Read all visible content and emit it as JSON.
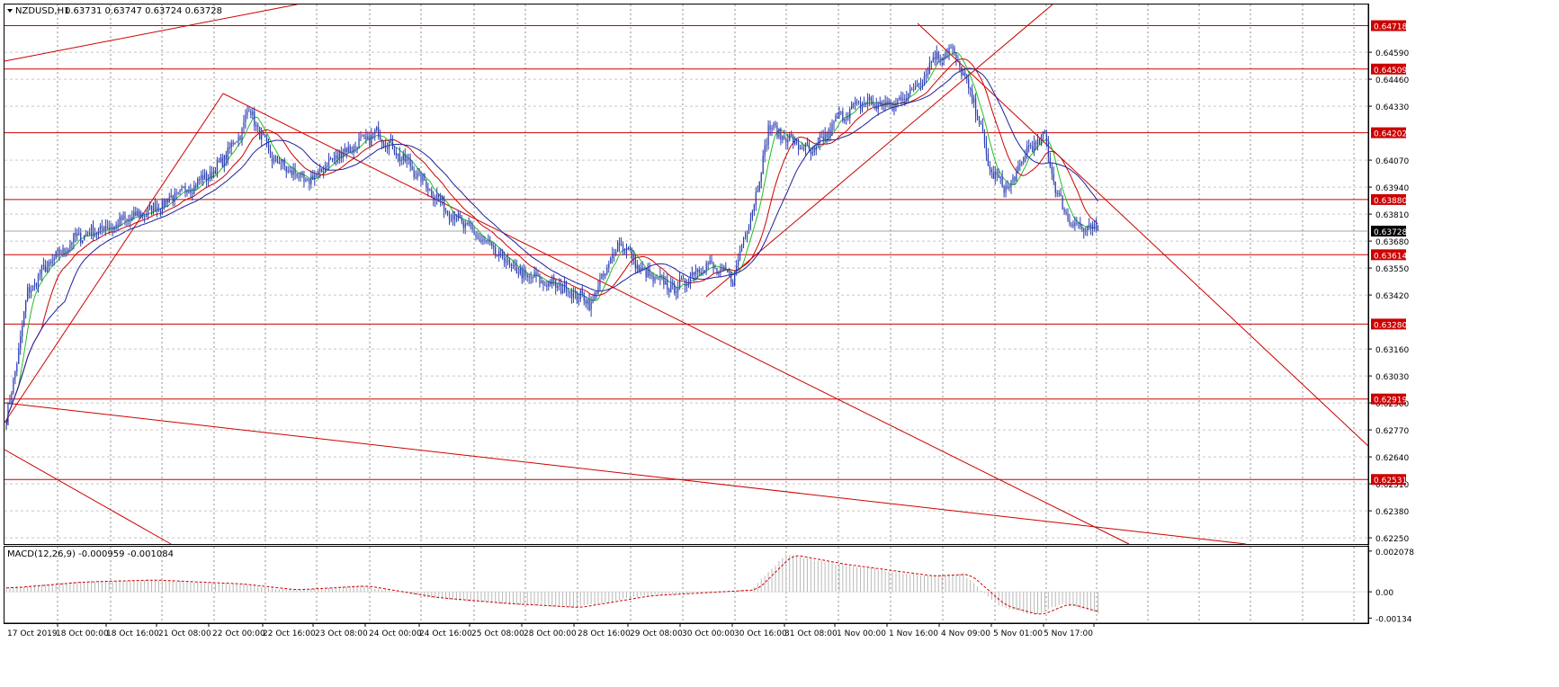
{
  "window": {
    "symbol": "NZDUSD,H1",
    "ohlc": "0.63731 0.63747 0.63724 0.63728"
  },
  "indicator": {
    "label": "MACD(12,26,9) -0.000959 -0.001084"
  },
  "price_axis": {
    "ticks": [
      "0.64590",
      "0.64460",
      "0.64330",
      "0.64070",
      "0.63940",
      "0.63810",
      "0.63680",
      "0.63550",
      "0.63420",
      "0.63160",
      "0.63030",
      "0.62900",
      "0.62770",
      "0.62640",
      "0.62510",
      "0.62380",
      "0.62250"
    ],
    "level_labels": [
      "0.64718",
      "0.64509",
      "0.64202",
      "0.63880",
      "0.63614",
      "0.63280",
      "0.62919",
      "0.62531"
    ],
    "current_price": "0.63728"
  },
  "macd_axis": {
    "ticks": [
      "0.002078",
      "0.00",
      "-0.00134"
    ]
  },
  "time_axis": {
    "labels": [
      "17 Oct 2019",
      "18 Oct 00:00",
      "18 Oct 16:00",
      "21 Oct 08:00",
      "22 Oct 00:00",
      "22 Oct 16:00",
      "23 Oct 08:00",
      "24 Oct 00:00",
      "24 Oct 16:00",
      "25 Oct 08:00",
      "28 Oct 00:00",
      "28 Oct 16:00",
      "29 Oct 08:00",
      "30 Oct 00:00",
      "30 Oct 16:00",
      "31 Oct 08:00",
      "1 Nov 00:00",
      "1 Nov 16:00",
      "4 Nov 09:00",
      "5 Nov 01:00",
      "5 Nov 17:00"
    ]
  },
  "colors": {
    "candle": "#2a3db0",
    "grid": "#c8c8c8",
    "level_line": "#cc0000",
    "ma_fast": "#20c020",
    "ma_mid": "#cc0000",
    "ma_slow": "#1e1e9e",
    "macd_hist": "#b8b8b8",
    "macd_signal": "#cc0000"
  },
  "chart_data": {
    "type": "candlestick",
    "symbol": "NZDUSD",
    "timeframe": "H1",
    "y_range": [
      0.6222,
      0.6482
    ],
    "horizontal_levels": [
      0.64718,
      0.64509,
      0.64202,
      0.6388,
      0.63614,
      0.6328,
      0.62919,
      0.62531
    ],
    "current_price": 0.63728,
    "price_path_anchors": [
      [
        0,
        0.6282
      ],
      [
        4,
        0.63
      ],
      [
        12,
        0.6343
      ],
      [
        22,
        0.6355
      ],
      [
        40,
        0.637
      ],
      [
        62,
        0.6376
      ],
      [
        82,
        0.6383
      ],
      [
        102,
        0.6393
      ],
      [
        118,
        0.6402
      ],
      [
        132,
        0.642
      ],
      [
        137,
        0.6432
      ],
      [
        148,
        0.641
      ],
      [
        158,
        0.6403
      ],
      [
        170,
        0.6396
      ],
      [
        186,
        0.6409
      ],
      [
        210,
        0.642
      ],
      [
        230,
        0.6402
      ],
      [
        250,
        0.6382
      ],
      [
        270,
        0.6367
      ],
      [
        290,
        0.6352
      ],
      [
        316,
        0.6345
      ],
      [
        330,
        0.6338
      ],
      [
        346,
        0.6368
      ],
      [
        360,
        0.6352
      ],
      [
        378,
        0.6345
      ],
      [
        394,
        0.6357
      ],
      [
        410,
        0.635
      ],
      [
        424,
        0.6393
      ],
      [
        430,
        0.6423
      ],
      [
        440,
        0.6418
      ],
      [
        455,
        0.641
      ],
      [
        470,
        0.6428
      ],
      [
        484,
        0.6435
      ],
      [
        500,
        0.6433
      ],
      [
        514,
        0.6443
      ],
      [
        524,
        0.6457
      ],
      [
        534,
        0.646
      ],
      [
        546,
        0.6435
      ],
      [
        556,
        0.64
      ],
      [
        566,
        0.6393
      ],
      [
        576,
        0.6412
      ],
      [
        586,
        0.6418
      ],
      [
        593,
        0.639
      ],
      [
        600,
        0.6378
      ],
      [
        610,
        0.6373
      ],
      [
        616,
        0.63728
      ]
    ],
    "macd_range": [
      -0.0016,
      0.0023
    ],
    "macd_path_anchors": [
      [
        0,
        0.0002
      ],
      [
        40,
        0.0005
      ],
      [
        80,
        0.0006
      ],
      [
        130,
        0.0004
      ],
      [
        160,
        0.0001
      ],
      [
        200,
        0.0003
      ],
      [
        240,
        -0.0003
      ],
      [
        280,
        -0.0006
      ],
      [
        320,
        -0.0008
      ],
      [
        360,
        -0.0002
      ],
      [
        420,
        0.0001
      ],
      [
        440,
        0.0019
      ],
      [
        470,
        0.0014
      ],
      [
        520,
        0.0008
      ],
      [
        540,
        0.0009
      ],
      [
        560,
        -0.0007
      ],
      [
        580,
        -0.0012
      ],
      [
        596,
        -0.0006
      ],
      [
        616,
        -0.0011
      ]
    ]
  }
}
